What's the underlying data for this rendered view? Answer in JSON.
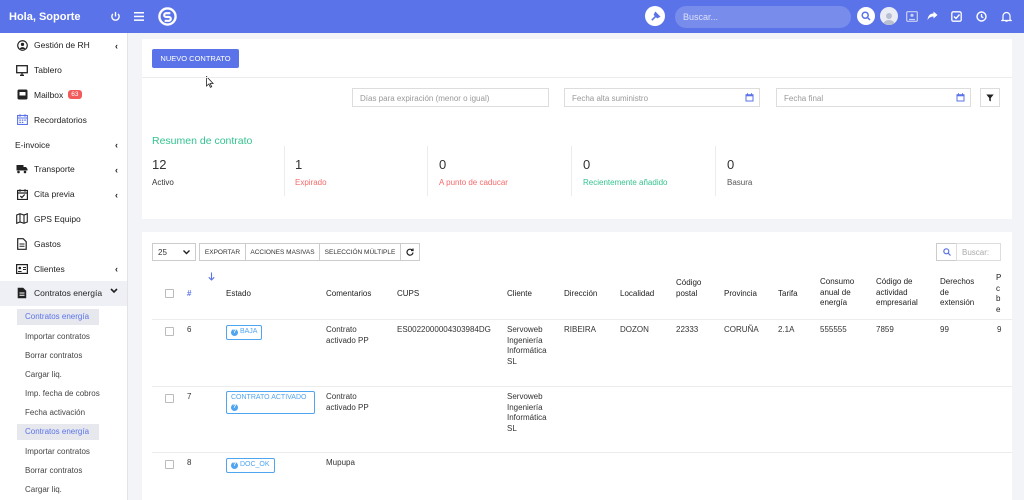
{
  "topbar": {
    "greeting": "Hola, Soporte",
    "search_placeholder": "Buscar...",
    "bg": "#5b73e8"
  },
  "sidebar": {
    "items": [
      {
        "label": "Gestión de RH",
        "icon": "user-circle-icon",
        "chevron": "‹"
      },
      {
        "label": "Tablero",
        "icon": "monitor-icon"
      },
      {
        "label": "Mailbox",
        "icon": "mailbox-icon",
        "badge": "63"
      },
      {
        "label": "Recordatorios",
        "icon": "calendar-icon"
      },
      {
        "label": "E-invoice",
        "chevron": "‹"
      },
      {
        "label": "Transporte",
        "icon": "truck-icon",
        "chevron": "‹"
      },
      {
        "label": "Cita previa",
        "icon": "calendar-check-icon",
        "chevron": "‹"
      },
      {
        "label": "GPS Equipo",
        "icon": "map-icon"
      },
      {
        "label": "Gastos",
        "icon": "file-icon"
      },
      {
        "label": "Clientes",
        "icon": "id-card-icon",
        "chevron": "‹"
      },
      {
        "label": "Contratos energía",
        "icon": "contract-icon",
        "chevron": "⌄"
      }
    ],
    "sub_group_1": [
      "Contratos energía",
      "Importar contratos",
      "Borrar contratos",
      "Cargar liq.",
      "Imp. fecha de cobros",
      "Fecha activación"
    ],
    "sub_group_2": [
      "Contratos energía",
      "Importar contratos",
      "Borrar contratos",
      "Cargar liq."
    ]
  },
  "main": {
    "new_contract_button": "NUEVO CONTRATO",
    "filters": {
      "expiration_placeholder": "Días para expiración (menor o igual)",
      "start_date_placeholder": "Fecha alta suministro",
      "end_date_placeholder": "Fecha final"
    },
    "summary": {
      "title": "Resumen de contrato",
      "stats": [
        {
          "value": "12",
          "label": "Activo",
          "color": "#333333"
        },
        {
          "value": "1",
          "label": "Expirado",
          "color": "#f46a6a"
        },
        {
          "value": "0",
          "label": "A punto de caducar",
          "color": "#f46a6a"
        },
        {
          "value": "0",
          "label": "Recientemente añadido",
          "color": "#34c38f"
        },
        {
          "value": "0",
          "label": "Basura",
          "color": "#555555"
        }
      ]
    },
    "table_controls": {
      "page_size": "25",
      "export": "EXPORTAR",
      "bulk_actions": "ACCIONES MASIVAS",
      "multi_select": "SELECCIÓN MÚLTIPLE",
      "search_placeholder": "Buscar:"
    },
    "table": {
      "headers": [
        "#",
        "Estado",
        "Comentarios",
        "CUPS",
        "Cliente",
        "Dirección",
        "Localidad",
        "Código postal",
        "Provincia",
        "Tarifa",
        "Consumo anual de energía",
        "Código de actividad empresarial",
        "Derechos de extensión",
        "P c b e"
      ],
      "rows": [
        {
          "id": "6",
          "estado": "BAJA",
          "comentarios": "Contrato activado PP",
          "cups": "ES0022000004303984DG",
          "cliente": "Servoweb Ingeniería Informática SL",
          "direccion": "RIBEIRA",
          "localidad": "DOZON",
          "cp": "22333",
          "provincia": "CORUÑA",
          "tarifa": "2.1A",
          "consumo": "555555",
          "actividad": "7859",
          "derechos": "99",
          "extra": "9"
        },
        {
          "id": "7",
          "estado": "CONTRATO ACTIVADO",
          "comentarios": "Contrato activado PP",
          "cups": "",
          "cliente": "Servoweb Ingeniería Informática SL",
          "direccion": "",
          "localidad": "",
          "cp": "",
          "provincia": "",
          "tarifa": "",
          "consumo": "",
          "actividad": "",
          "derechos": "",
          "extra": ""
        },
        {
          "id": "8",
          "estado": "DOC_OK",
          "comentarios": "Mupupa",
          "cups": "",
          "cliente": "",
          "direccion": "",
          "localidad": "",
          "cp": "",
          "provincia": "",
          "tarifa": "",
          "consumo": "",
          "actividad": "",
          "derechos": "",
          "extra": ""
        }
      ]
    }
  }
}
